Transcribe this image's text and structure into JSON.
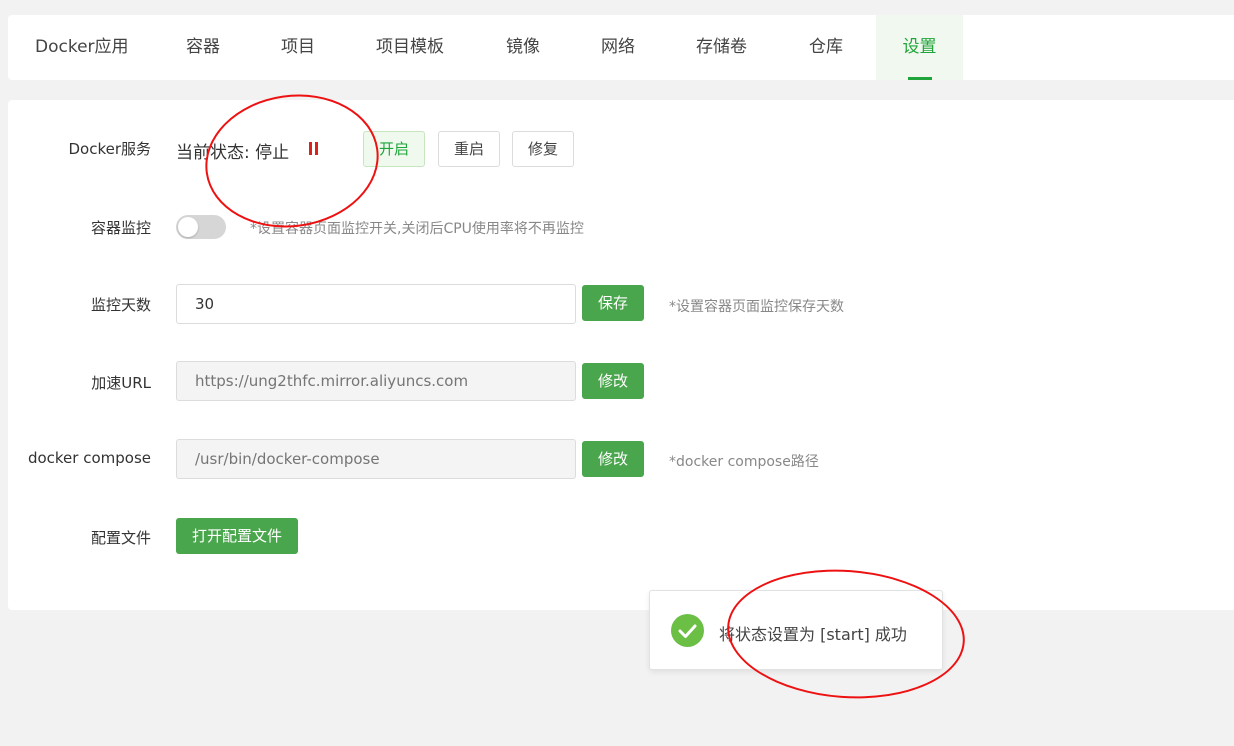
{
  "tabs": [
    {
      "label": "Docker应用"
    },
    {
      "label": "容器"
    },
    {
      "label": "项目"
    },
    {
      "label": "项目模板"
    },
    {
      "label": "镜像"
    },
    {
      "label": "网络"
    },
    {
      "label": "存储卷"
    },
    {
      "label": "仓库"
    },
    {
      "label": "设置",
      "active": true
    }
  ],
  "service": {
    "label": "Docker服务",
    "status_prefix": "当前状态:",
    "status_value": "停止",
    "start_button": "开启",
    "restart_button": "重启",
    "repair_button": "修复",
    "pause_color": "#d9231c"
  },
  "monitor": {
    "label": "容器监控",
    "enabled": false,
    "hint": "*设置容器页面监控开关,关闭后CPU使用率将不再监控"
  },
  "monitor_days": {
    "label": "监控天数",
    "value": "30",
    "save_button": "保存",
    "hint": "*设置容器页面监控保存天数"
  },
  "mirror": {
    "label": "加速URL",
    "placeholder": "https://ung2thfc.mirror.aliyuncs.com",
    "edit_button": "修改"
  },
  "compose": {
    "label": "docker compose",
    "placeholder": "/usr/bin/docker-compose",
    "edit_button": "修改",
    "hint": "*docker compose路径"
  },
  "config": {
    "label": "配置文件",
    "open_button": "打开配置文件"
  },
  "toast": {
    "message": "将状态设置为 [start] 成功",
    "icon": "check-circle-icon",
    "color": "#6bbf45"
  },
  "colors": {
    "accent": "#20a53a",
    "button_green": "#4aa64c",
    "annotation_red": "#e11111"
  }
}
